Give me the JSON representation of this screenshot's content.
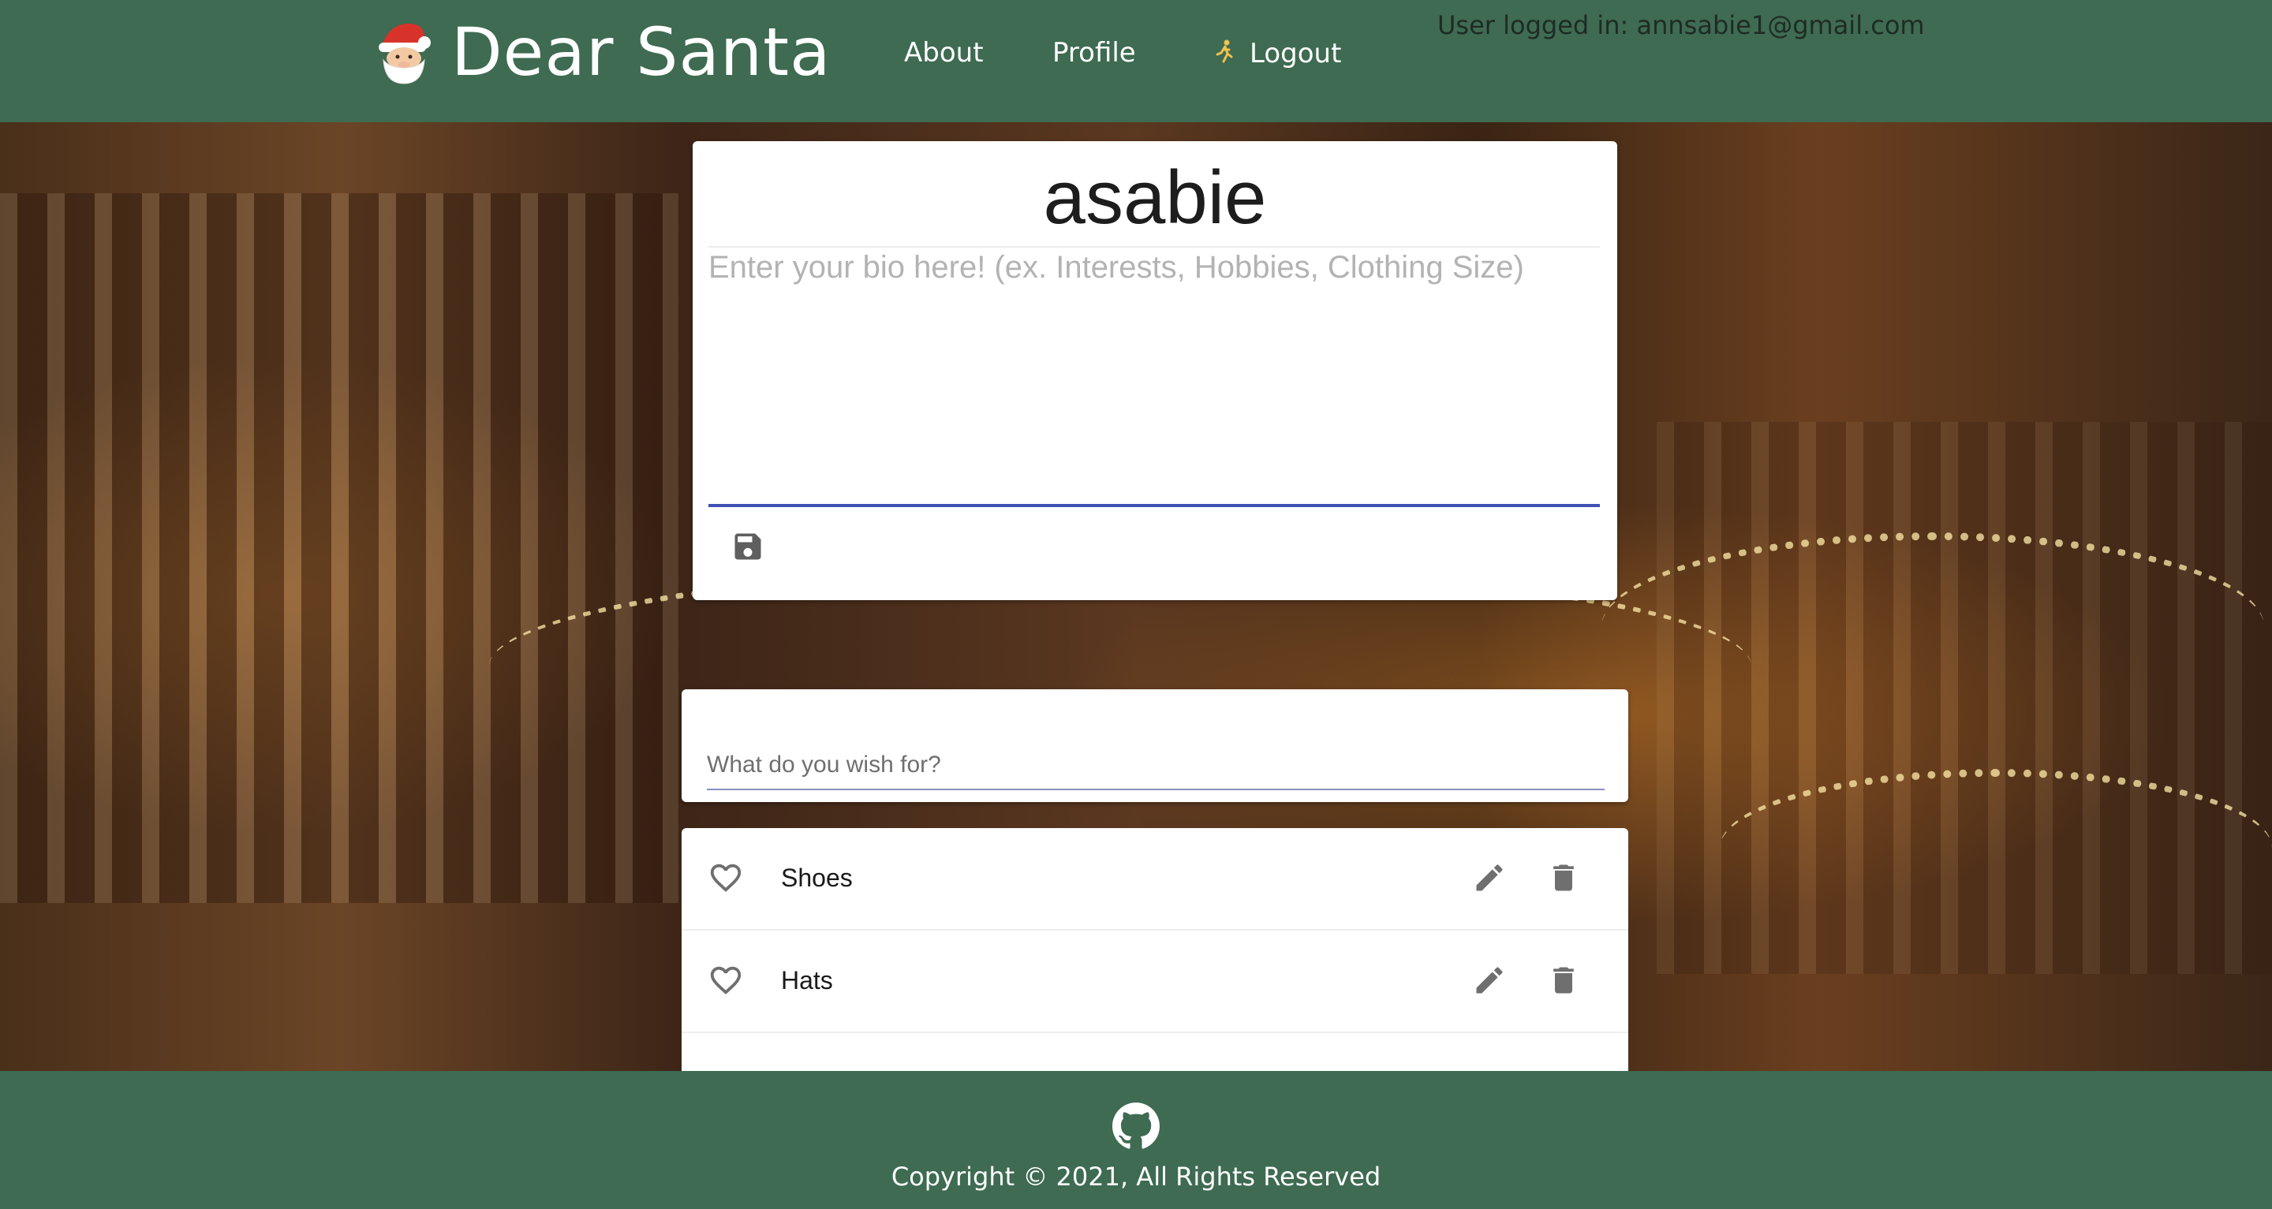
{
  "header": {
    "brand_title": "Dear Santa",
    "brand_icon": "santa-icon",
    "nav": {
      "about": "About",
      "profile": "Profile",
      "logout": "Logout"
    },
    "logout_icon": "runner-icon",
    "user_info": "User logged in: annsabie1@gmail.com"
  },
  "profile": {
    "username": "asabie",
    "bio_value": "",
    "bio_placeholder": "Enter your bio here! (ex. Interests, Hobbies, Clothing Size)",
    "save_icon": "save-icon"
  },
  "wish_form": {
    "value": "",
    "placeholder": "What do you wish for?"
  },
  "wishes": [
    {
      "label": "Shoes"
    },
    {
      "label": "Hats"
    }
  ],
  "footer": {
    "github_icon": "github-icon",
    "copyright": "Copyright © 2021, All Rights Reserved"
  },
  "colors": {
    "header_bg": "#3e6b51",
    "accent": "#3f51b5",
    "icon_gray": "#757575"
  }
}
